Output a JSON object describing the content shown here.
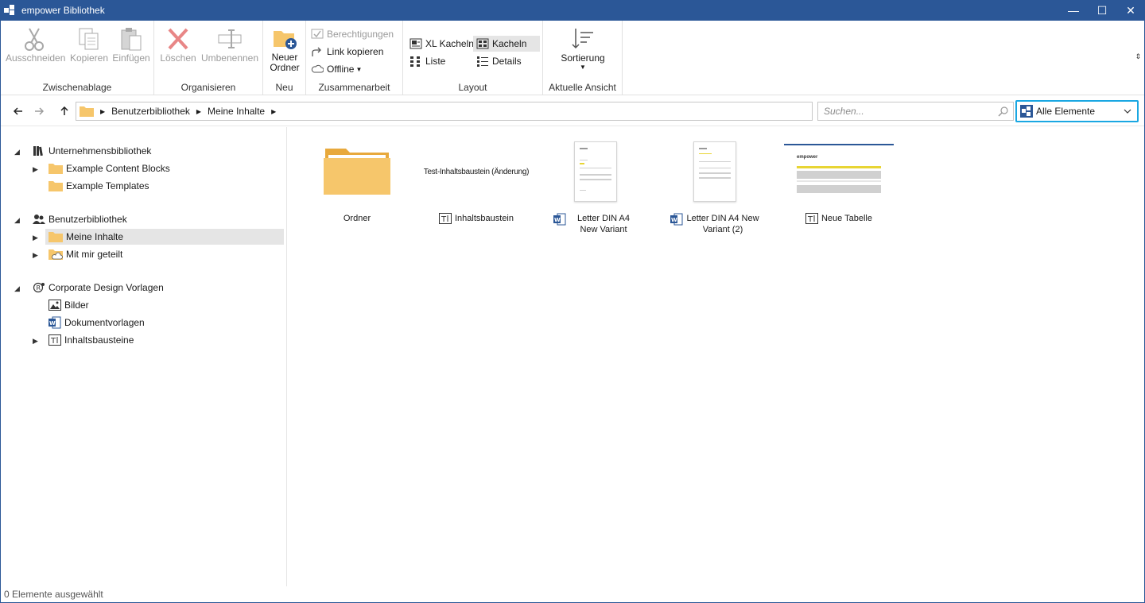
{
  "window": {
    "title": "empower Bibliothek",
    "minimize": "—",
    "maximize": "☐",
    "close": "✕"
  },
  "ribbon": {
    "groups": {
      "clipboard": "Zwischenablage",
      "organize": "Organisieren",
      "new": "Neu",
      "collab": "Zusammenarbeit",
      "layout": "Layout",
      "view": "Aktuelle Ansicht"
    },
    "cut": "Ausschneiden",
    "copy": "Kopieren",
    "paste": "Einfügen",
    "delete": "Löschen",
    "rename": "Umbenennen",
    "new_folder_line1": "Neuer",
    "new_folder_line2": "Ordner",
    "permissions": "Berechtigungen",
    "copy_link": "Link kopieren",
    "offline": "Offline",
    "xl_tiles": "XL Kacheln",
    "tiles": "Kacheln",
    "list": "Liste",
    "details": "Details",
    "sort": "Sortierung"
  },
  "address": {
    "crumbs": [
      "Benutzerbibliothek",
      "Meine Inhalte"
    ],
    "search_placeholder": "Suchen...",
    "filter": "Alle Elemente"
  },
  "tree": {
    "company_library": "Unternehmensbibliothek",
    "example_blocks": "Example Content Blocks",
    "example_templates": "Example Templates",
    "user_library": "Benutzerbibliothek",
    "my_content": "Meine Inhalte",
    "shared_with_me": "Mit mir geteilt",
    "cd_templates": "Corporate Design Vorlagen",
    "images": "Bilder",
    "doc_templates": "Dokumentvorlagen",
    "content_blocks": "Inhaltsbausteine"
  },
  "tiles": [
    {
      "caption": "Ordner"
    },
    {
      "caption": "Inhaltsbaustein",
      "preview_text": "Test-Inhaltsbaustein (Änderung)"
    },
    {
      "caption": "Letter DIN A4 New Variant"
    },
    {
      "caption": "Letter DIN A4 New Variant (2)"
    },
    {
      "caption": "Neue Tabelle"
    }
  ],
  "table_logo": "empower",
  "status": "0 Elemente ausgewählt",
  "colors": {
    "accent": "#2b5797",
    "highlight": "#1aa7e2",
    "folder": "#f6c66b"
  }
}
